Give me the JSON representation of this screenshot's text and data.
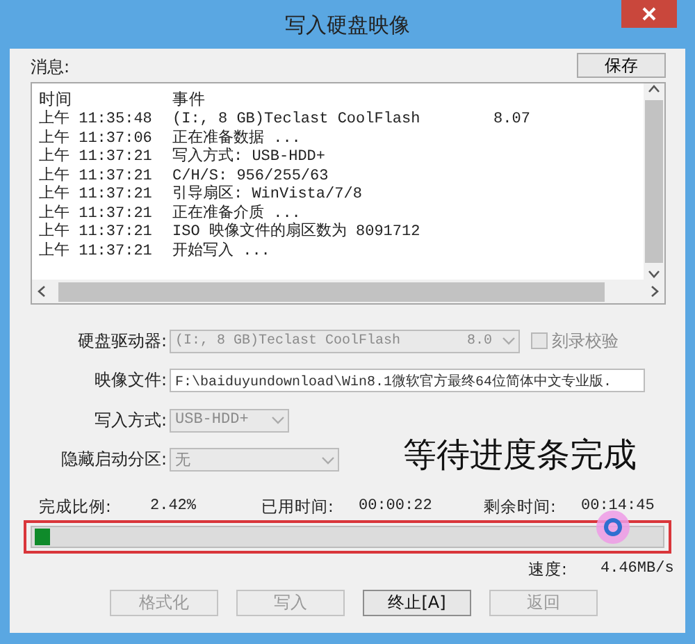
{
  "window": {
    "title": "写入硬盘映像"
  },
  "messages": {
    "label": "消息:",
    "save_button": "保存",
    "columns": [
      "时间",
      "事件"
    ],
    "rows": [
      {
        "time": "上午 11:35:48",
        "event": "(I:, 8 GB)Teclast CoolFlash        8.07"
      },
      {
        "time": "上午 11:37:06",
        "event": "正在准备数据 ..."
      },
      {
        "time": "上午 11:37:21",
        "event": "写入方式: USB-HDD+"
      },
      {
        "time": "上午 11:37:21",
        "event": "C/H/S: 956/255/63"
      },
      {
        "time": "上午 11:37:21",
        "event": "引导扇区: WinVista/7/8"
      },
      {
        "time": "上午 11:37:21",
        "event": "正在准备介质 ..."
      },
      {
        "time": "上午 11:37:21",
        "event": "ISO 映像文件的扇区数为 8091712"
      },
      {
        "time": "上午 11:37:21",
        "event": "开始写入 ..."
      }
    ]
  },
  "form": [
    {
      "kind": "combo",
      "label": "硬盘驱动器:",
      "value": "(I:, 8 GB)Teclast CoolFlash        8.0",
      "disabled": true,
      "checkbox": {
        "label": "刻录校验",
        "checked": false,
        "disabled": true
      }
    },
    {
      "kind": "text",
      "label": "映像文件:",
      "value": "F:\\baiduyundownload\\Win8.1微软官方最终64位简体中文专业版.",
      "disabled": false
    },
    {
      "kind": "combo",
      "label": "写入方式:",
      "value": "USB-HDD+",
      "disabled": true
    },
    {
      "kind": "combo",
      "label": "隐藏启动分区:",
      "value": "无",
      "disabled": true
    }
  ],
  "progress": {
    "percent_label": "完成比例:",
    "percent": "2.42%",
    "elapsed_label": "已用时间:",
    "elapsed": "00:00:22",
    "remaining_label": "剩余时间:",
    "remaining": "00:14:45",
    "level": 0.0242,
    "speed_label": "速度:",
    "speed": "4.46MB/s"
  },
  "buttons": [
    {
      "label": "格式化",
      "disabled": true
    },
    {
      "label": "写入",
      "disabled": true
    },
    {
      "label": "终止[A]",
      "disabled": false
    },
    {
      "label": "返回",
      "disabled": true
    }
  ],
  "annotation": {
    "text": "等待进度条完成"
  }
}
